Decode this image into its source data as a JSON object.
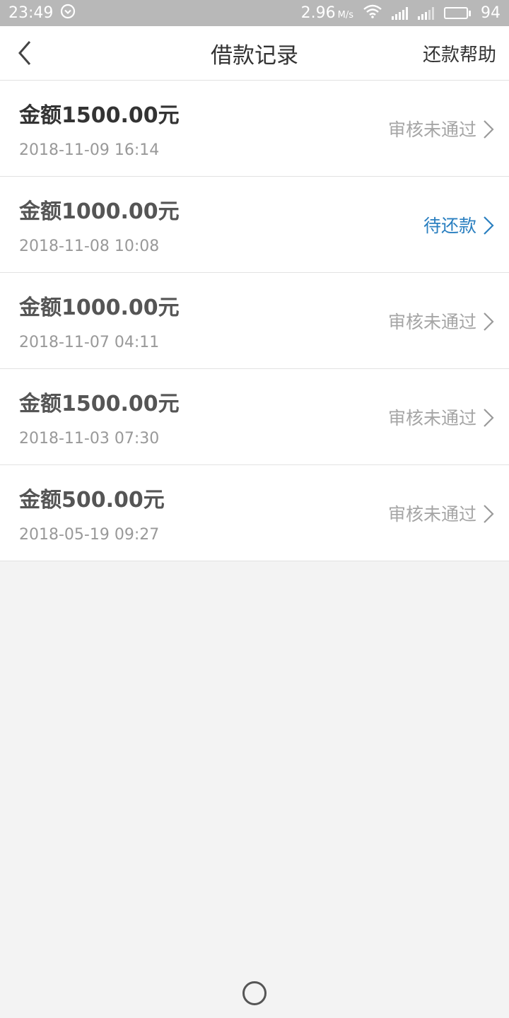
{
  "status_bar": {
    "time": "23:49",
    "speed_value": "2.96",
    "speed_unit": "M/s",
    "battery": "94",
    "battery_level_percent": 94,
    "icons": [
      "notification-icon",
      "wifi-icon",
      "signal-icon",
      "signal-icon",
      "battery-icon"
    ]
  },
  "navbar": {
    "back_icon": "chevron-left-icon",
    "title": "借款记录",
    "help_label": "还款帮助"
  },
  "records": [
    {
      "amount": "金额1500.00元",
      "datetime": "2018-11-09 16:14",
      "status": "审核未通过",
      "status_color": "#a5a5a5"
    },
    {
      "amount": "金额1000.00元",
      "datetime": "2018-11-08 10:08",
      "status": "待还款",
      "status_color": "#2a7fc0"
    },
    {
      "amount": "金额1000.00元",
      "datetime": "2018-11-07 04:11",
      "status": "审核未通过",
      "status_color": "#a5a5a5"
    },
    {
      "amount": "金额1500.00元",
      "datetime": "2018-11-03 07:30",
      "status": "审核未通过",
      "status_color": "#a5a5a5"
    },
    {
      "amount": "金额500.00元",
      "datetime": "2018-05-19 09:27",
      "status": "审核未通过",
      "status_color": "#a5a5a5"
    }
  ],
  "colors": {
    "status_bar_bg": "#b8b8b8",
    "page_bg": "#f3f3f3",
    "pending_blue": "#2a7fc0",
    "rejected_gray": "#a5a5a5"
  }
}
